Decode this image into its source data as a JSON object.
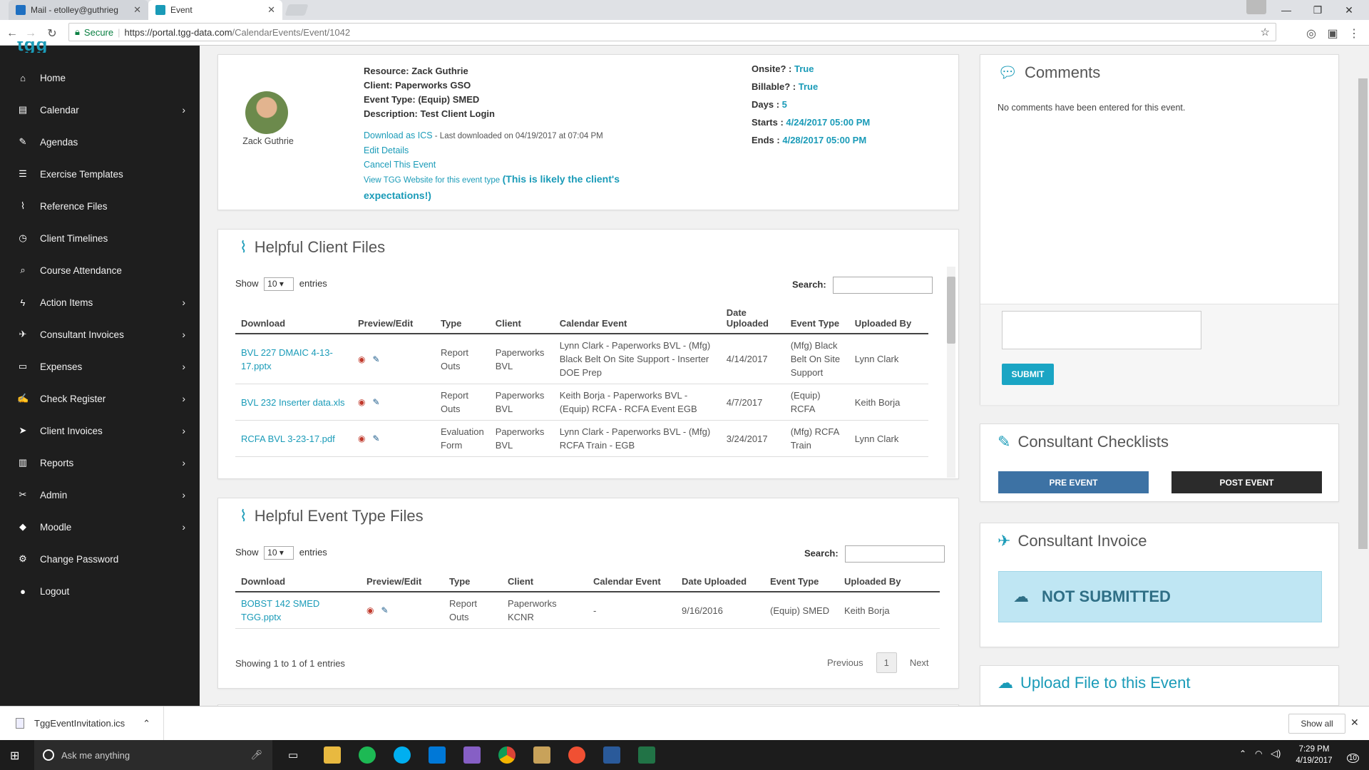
{
  "browser": {
    "tab1_title": "Mail - etolley@guthrieg",
    "tab2_title": "Event",
    "secure_label": "Secure",
    "url_base": "https://portal.tgg-data.com",
    "url_path": "/CalendarEvents/Event/1042"
  },
  "sidebar": {
    "logo": "tgg",
    "items": [
      {
        "label": "Home",
        "icon": "home-icon",
        "glyph": "⌂",
        "chevron": false
      },
      {
        "label": "Calendar",
        "icon": "calendar-icon",
        "glyph": "▤",
        "chevron": true
      },
      {
        "label": "Agendas",
        "icon": "book-icon",
        "glyph": "✎",
        "chevron": false
      },
      {
        "label": "Exercise Templates",
        "icon": "list-icon",
        "glyph": "☰",
        "chevron": false
      },
      {
        "label": "Reference Files",
        "icon": "paperclip-icon",
        "glyph": "⌇",
        "chevron": false
      },
      {
        "label": "Client Timelines",
        "icon": "clock-icon",
        "glyph": "◷",
        "chevron": false
      },
      {
        "label": "Course Attendance",
        "icon": "search-icon",
        "glyph": "⌕",
        "chevron": false
      },
      {
        "label": "Action Items",
        "icon": "bolt-icon",
        "glyph": "ϟ",
        "chevron": true
      },
      {
        "label": "Consultant Invoices",
        "icon": "plane-icon",
        "glyph": "✈",
        "chevron": true
      },
      {
        "label": "Expenses",
        "icon": "credit-card-icon",
        "glyph": "▭",
        "chevron": true
      },
      {
        "label": "Check Register",
        "icon": "edit-icon",
        "glyph": "✍",
        "chevron": true
      },
      {
        "label": "Client Invoices",
        "icon": "send-icon",
        "glyph": "➤",
        "chevron": true
      },
      {
        "label": "Reports",
        "icon": "bar-chart-icon",
        "glyph": "▥",
        "chevron": true
      },
      {
        "label": "Admin",
        "icon": "tools-icon",
        "glyph": "✂",
        "chevron": true
      },
      {
        "label": "Moodle",
        "icon": "graduation-icon",
        "glyph": "◆",
        "chevron": true
      },
      {
        "label": "Change Password",
        "icon": "gear-icon",
        "glyph": "⚙",
        "chevron": false
      },
      {
        "label": "Logout",
        "icon": "power-icon",
        "glyph": "●",
        "chevron": false
      }
    ]
  },
  "event": {
    "person_name": "Zack Guthrie",
    "resource_label": "Resource:",
    "resource": "Zack Guthrie",
    "client_label": "Client:",
    "client": "Paperworks GSO",
    "type_label": "Event Type:",
    "type": "(Equip) SMED",
    "desc_label": "Description:",
    "desc": "Test Client Login",
    "download_link": "Download as ICS",
    "last_downloaded": " - Last downloaded on 04/19/2017 at 07:04 PM",
    "edit_link": "Edit Details",
    "cancel_link": "Cancel This Event",
    "website_link": "View TGG Website for this event type",
    "website_note": "(This is likely the client's expectations!)",
    "onsite_label": "Onsite? :",
    "onsite": "True",
    "billable_label": "Billable? :",
    "billable": "True",
    "days_label": "Days :",
    "days": "5",
    "starts_label": "Starts :",
    "starts": "4/24/2017 05:00 PM",
    "ends_label": "Ends :",
    "ends": "4/28/2017 05:00 PM"
  },
  "client_files": {
    "title": "Helpful Client Files",
    "show": "Show",
    "entries_count": "10",
    "entries": "entries",
    "search_label": "Search:",
    "headers": [
      "Download",
      "Preview/Edit",
      "Type",
      "Client",
      "Calendar Event",
      "Date Uploaded",
      "Event Type",
      "Uploaded By"
    ],
    "rows": [
      {
        "file": "BVL 227 DMAIC 4-13-17.pptx",
        "type": "Report Outs",
        "client": "Paperworks BVL",
        "event": "Lynn Clark - Paperworks BVL - (Mfg) Black Belt On Site Support - Inserter DOE Prep",
        "date": "4/14/2017",
        "etype": "(Mfg) Black Belt On Site Support",
        "by": "Lynn Clark"
      },
      {
        "file": "BVL 232 Inserter data.xls",
        "type": "Report Outs",
        "client": "Paperworks BVL",
        "event": "Keith Borja - Paperworks BVL - (Equip) RCFA - RCFA Event EGB",
        "date": "4/7/2017",
        "etype": "(Equip) RCFA",
        "by": "Keith Borja"
      },
      {
        "file": "RCFA BVL 3-23-17.pdf",
        "type": "Evaluation Form",
        "client": "Paperworks BVL",
        "event": "Lynn Clark - Paperworks BVL - (Mfg) RCFA Train - EGB",
        "date": "3/24/2017",
        "etype": "(Mfg) RCFA Train",
        "by": "Lynn Clark"
      }
    ]
  },
  "event_type_files": {
    "title": "Helpful Event Type Files",
    "show": "Show",
    "entries_count": "10",
    "entries": "entries",
    "search_label": "Search:",
    "headers": [
      "Download",
      "Preview/Edit",
      "Type",
      "Client",
      "Calendar Event",
      "Date Uploaded",
      "Event Type",
      "Uploaded By"
    ],
    "rows": [
      {
        "file": "BOBST 142 SMED TGG.pptx",
        "type": "Report Outs",
        "client": "Paperworks KCNR",
        "event": "-",
        "date": "9/16/2016",
        "etype": "(Equip) SMED",
        "by": "Keith Borja"
      }
    ],
    "info": "Showing 1 to 1 of 1 entries",
    "prev": "Previous",
    "page": "1",
    "next": "Next"
  },
  "comments": {
    "title": "Comments",
    "empty": "No comments have been entered for this event.",
    "submit": "SUBMIT"
  },
  "checklists": {
    "title": "Consultant Checklists",
    "pre": "PRE EVENT",
    "post": "POST EVENT"
  },
  "invoice": {
    "title": "Consultant Invoice",
    "status": "NOT SUBMITTED"
  },
  "upload": {
    "title": "Upload File to this Event"
  },
  "downloads_bar": {
    "file": "TggEventInvitation.ics",
    "show_all": "Show all"
  },
  "taskbar": {
    "search_placeholder": "Ask me anything",
    "time": "7:29 PM",
    "date": "4/19/2017",
    "notif_count": "10"
  },
  "colors": {
    "accent": "#1a9bb8",
    "sidebar": "#1e1e1e",
    "pre_event": "#3d72a4",
    "post_event": "#2b2b2b",
    "not_submitted_bg": "#bfe6f3"
  }
}
